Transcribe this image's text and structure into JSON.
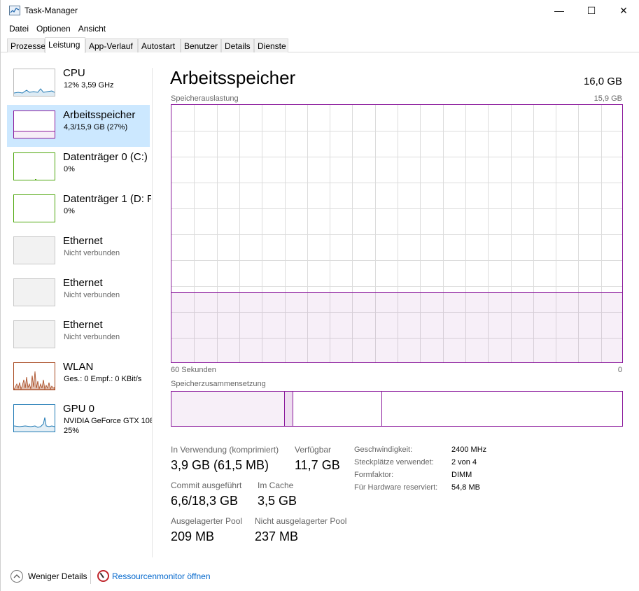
{
  "window": {
    "title": "Task-Manager",
    "controls": {
      "minimize": "—",
      "maximize": "☐",
      "close": "✕"
    }
  },
  "menu": [
    "Datei",
    "Optionen",
    "Ansicht"
  ],
  "tabs": [
    {
      "label": "Prozesse",
      "active": false
    },
    {
      "label": "Leistung",
      "active": true
    },
    {
      "label": "App-Verlauf",
      "active": false
    },
    {
      "label": "Autostart",
      "active": false
    },
    {
      "label": "Benutzer",
      "active": false
    },
    {
      "label": "Details",
      "active": false
    },
    {
      "label": "Dienste",
      "active": false
    }
  ],
  "sidebar": {
    "items": [
      {
        "title": "CPU",
        "sub": "12% 3,59 GHz",
        "color": "#1f79b4",
        "selected": false
      },
      {
        "title": "Arbeitsspeicher",
        "sub": "4,3/15,9 GB (27%)",
        "color": "#8b1a9c",
        "selected": true
      },
      {
        "title": "Datenträger 0 (C:)",
        "sub": "0%",
        "color": "#4da60c",
        "selected": false
      },
      {
        "title": "Datenträger 1 (D: F",
        "sub": "0%",
        "color": "#4da60c",
        "selected": false
      },
      {
        "title": "Ethernet",
        "sub": "Nicht verbunden",
        "color": "#c8c8c8",
        "selected": false
      },
      {
        "title": "Ethernet",
        "sub": "Nicht verbunden",
        "color": "#c8c8c8",
        "selected": false
      },
      {
        "title": "Ethernet",
        "sub": "Nicht verbunden",
        "color": "#c8c8c8",
        "selected": false
      },
      {
        "title": "WLAN",
        "sub": "Ges.: 0 Empf.: 0 KBit/s",
        "color": "#a7481f",
        "selected": false
      },
      {
        "title": "GPU 0",
        "sub": "NVIDIA GeForce GTX 108",
        "sub2": "25%",
        "color": "#1f79b4",
        "selected": false
      }
    ]
  },
  "main": {
    "title": "Arbeitsspeicher",
    "total": "16,0 GB",
    "graph_label": "Speicherauslastung",
    "graph_max": "15,9 GB",
    "graph_time_left": "60 Sekunden",
    "graph_time_right": "0",
    "usage_fraction": 0.27,
    "composition_label": "Speicherzusammensetzung",
    "composition": {
      "in_use_fraction": 0.25,
      "modified_fraction": 0.02,
      "standby_fraction": 0.197
    },
    "stats": {
      "in_use_label": "In Verwendung (komprimiert)",
      "in_use_value": "3,9 GB (61,5 MB)",
      "available_label": "Verfügbar",
      "available_value": "11,7 GB",
      "committed_label": "Commit ausgeführt",
      "committed_value": "6,6/18,3 GB",
      "cached_label": "Im Cache",
      "cached_value": "3,5 GB",
      "paged_label": "Ausgelagerter Pool",
      "paged_value": "209 MB",
      "nonpaged_label": "Nicht ausgelagerter Pool",
      "nonpaged_value": "237 MB"
    },
    "details": [
      {
        "label": "Geschwindigkeit:",
        "value": "2400 MHz"
      },
      {
        "label": "Steckplätze verwendet:",
        "value": "2 von 4"
      },
      {
        "label": "Formfaktor:",
        "value": "DIMM"
      },
      {
        "label": "Für Hardware reserviert:",
        "value": "54,8 MB"
      }
    ]
  },
  "footer": {
    "fewer_details": "Weniger Details",
    "resource_monitor": "Ressourcenmonitor öffnen"
  },
  "colors": {
    "memory_accent": "#8b1a9c",
    "selection": "#cce8ff",
    "link": "#0066cc"
  }
}
